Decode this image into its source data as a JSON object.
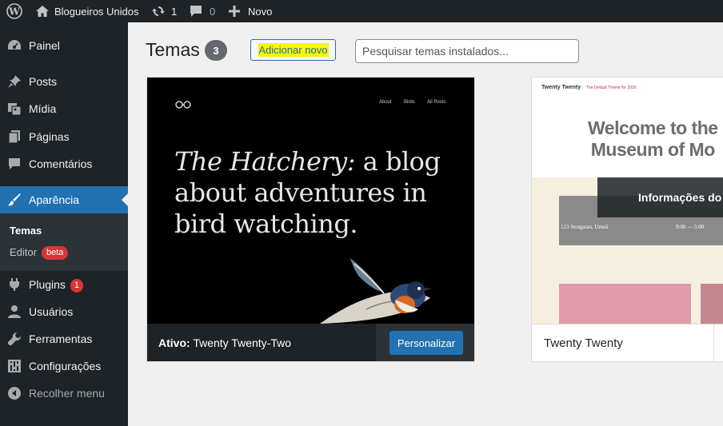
{
  "adminbar": {
    "site_name": "Blogueiros Unidos",
    "updates_count": "1",
    "comments_count": "0",
    "new_label": "Novo"
  },
  "sidebar": {
    "items": [
      {
        "label": "Painel",
        "icon": "dashboard-icon"
      },
      {
        "label": "Posts",
        "icon": "pin-icon"
      },
      {
        "label": "Mídia",
        "icon": "media-icon"
      },
      {
        "label": "Páginas",
        "icon": "pages-icon"
      },
      {
        "label": "Comentários",
        "icon": "comments-icon"
      },
      {
        "label": "Aparência",
        "icon": "brush-icon"
      },
      {
        "label": "Plugins",
        "icon": "plugin-icon",
        "badge": "1"
      },
      {
        "label": "Usuários",
        "icon": "users-icon"
      },
      {
        "label": "Ferramentas",
        "icon": "wrench-icon"
      },
      {
        "label": "Configurações",
        "icon": "settings-icon"
      },
      {
        "label": "Recolher menu",
        "icon": "collapse-icon"
      }
    ],
    "submenu": {
      "themes": "Temas",
      "editor": "Editor",
      "editor_badge": "beta"
    }
  },
  "main": {
    "title": "Temas",
    "count": "3",
    "add_new": "Adicionar novo",
    "search_placeholder": "Pesquisar temas instalados..."
  },
  "themes": {
    "active": {
      "status_label": "Ativo:",
      "name": "Twenty Twenty-Two",
      "customize_label": "Personalizar",
      "screenshot": {
        "nav": [
          "About",
          "Birds",
          "All Posts"
        ],
        "title_em": "The Hatchery:",
        "title_rest": " a blog about adventures in bird watching."
      }
    },
    "second": {
      "name": "Twenty Twenty",
      "details_label": "Informações do",
      "screenshot": {
        "site": "Twenty Twenty",
        "tagline": "The Default Theme for 2020",
        "welcome_1": "Welcome to the",
        "welcome_2": "Museum of Mo",
        "address": "123 Storgatan, Umeå",
        "hours": "9:00 — 5:00"
      }
    }
  },
  "colors": {
    "admin_dark": "#1d2327",
    "accent_blue": "#2271b1",
    "badge_red": "#d63638",
    "highlight_yellow": "#f7f700"
  }
}
